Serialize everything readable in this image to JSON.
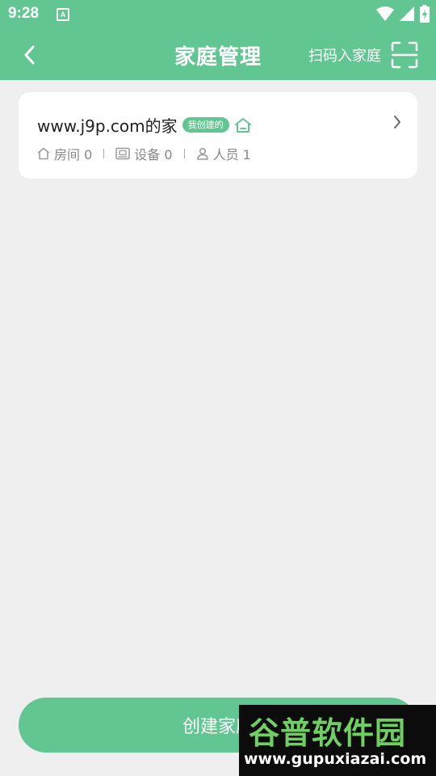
{
  "status_bar": {
    "time": "9:28",
    "notification_letter": "A"
  },
  "header": {
    "title": "家庭管理",
    "scan_label": "扫码入家庭"
  },
  "home_card": {
    "name": "www.j9p.com的家",
    "badge": "我创建的",
    "stats": [
      {
        "icon": "house-icon",
        "label": "房间 0"
      },
      {
        "icon": "device-icon",
        "label": "设备 0"
      },
      {
        "icon": "person-icon",
        "label": "人员 1"
      }
    ]
  },
  "footer": {
    "create_label": "创建家庭"
  },
  "watermark": {
    "logo": "谷普软件园",
    "url": "www.gupuxiazai.com"
  },
  "colors": {
    "accent": "#62c693",
    "background": "#efefef",
    "card": "#ffffff"
  }
}
